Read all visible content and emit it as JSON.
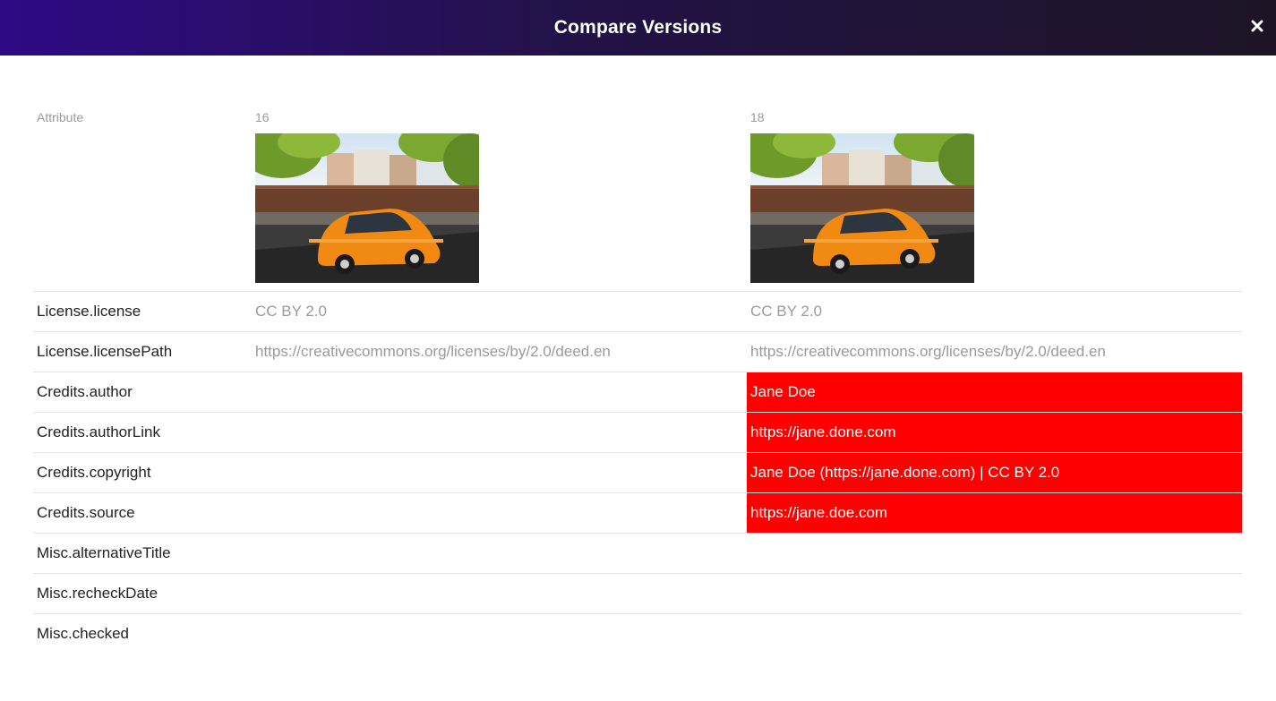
{
  "header": {
    "title": "Compare Versions",
    "close_label": "Close"
  },
  "columns": {
    "attribute_label": "Attribute",
    "version_a": "16",
    "version_b": "18"
  },
  "rows": [
    {
      "attribute": "License.license",
      "a": "CC BY 2.0",
      "b": "CC BY 2.0",
      "changed": false
    },
    {
      "attribute": "License.licensePath",
      "a": "https://creativecommons.org/licenses/by/2.0/deed.en",
      "b": "https://creativecommons.org/licenses/by/2.0/deed.en",
      "changed": false
    },
    {
      "attribute": "Credits.author",
      "a": "",
      "b": "Jane Doe",
      "changed": true
    },
    {
      "attribute": "Credits.authorLink",
      "a": "",
      "b": "https://jane.done.com",
      "changed": true
    },
    {
      "attribute": "Credits.copyright",
      "a": "",
      "b": "Jane Doe (https://jane.done.com) | CC BY 2.0",
      "changed": true
    },
    {
      "attribute": "Credits.source",
      "a": "",
      "b": "https://jane.doe.com",
      "changed": true
    },
    {
      "attribute": "Misc.alternativeTitle",
      "a": "",
      "b": "",
      "changed": false
    },
    {
      "attribute": "Misc.recheckDate",
      "a": "",
      "b": "",
      "changed": false
    },
    {
      "attribute": "Misc.checked",
      "a": "",
      "b": "",
      "changed": false
    }
  ],
  "colors": {
    "header_start": "#2e0a85",
    "header_end": "#1d1526",
    "changed_bg": "#ff0000",
    "changed_text": "#ffffff",
    "muted_text": "#9a9a9a"
  },
  "icons": {
    "close": "close-icon",
    "thumbnail": "orange-car-photo"
  }
}
